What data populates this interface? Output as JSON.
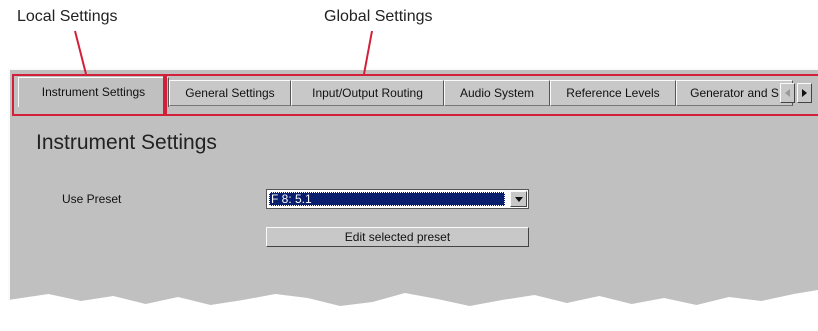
{
  "callouts": {
    "local": "Local Settings",
    "global": "Global Settings",
    "accent_color": "#d3203a"
  },
  "tabs": [
    {
      "label": "Instrument Settings",
      "active": true
    },
    {
      "label": "General Settings",
      "active": false
    },
    {
      "label": "Input/Output Routing",
      "active": false
    },
    {
      "label": "Audio System",
      "active": false
    },
    {
      "label": "Reference Levels",
      "active": false
    },
    {
      "label": "Generator and S",
      "active": false
    }
  ],
  "tab_scroll": {
    "left_icon": "arrow-left-icon",
    "right_icon": "arrow-right-icon"
  },
  "page": {
    "title": "Instrument Settings",
    "use_preset_label": "Use Preset",
    "preset_value": "F 8: 5.1",
    "preset_dropdown_icon": "chevron-down-icon",
    "edit_button_label": "Edit selected preset"
  }
}
